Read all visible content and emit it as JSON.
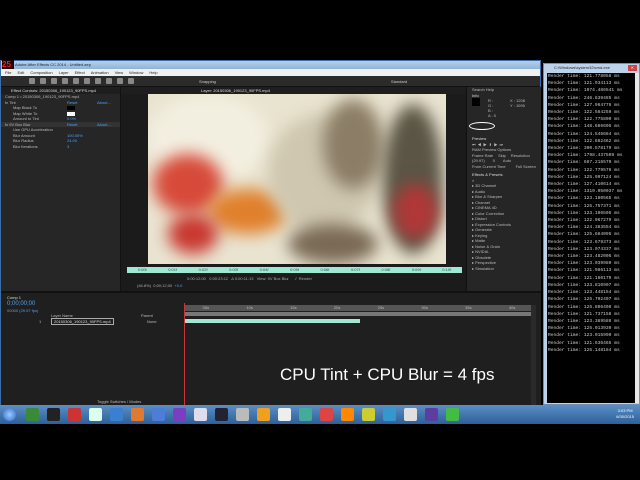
{
  "ae": {
    "title": "Adobe After Effects CC 2014 - Untitled.aep",
    "logo": "25",
    "menu": [
      "File",
      "Edit",
      "Composition",
      "Layer",
      "Effect",
      "Animation",
      "View",
      "Window",
      "Help"
    ],
    "workspace": "Standard",
    "effect_controls": {
      "tab": "Effect Controls: 20150306_190123_90FPS.mp4",
      "breadcrumb": "Comp 1 • 20150306_190123_90FPS.mp4",
      "rows": [
        {
          "name": "fx Tint",
          "value": "Reset",
          "about": "About..."
        },
        {
          "name": "Map Black To",
          "value": "",
          "about": ""
        },
        {
          "name": "Map White To",
          "value": "",
          "about": ""
        },
        {
          "name": "Amount to Tint",
          "value": "0.0%",
          "about": ""
        },
        {
          "name": "fx 9V Box Blur",
          "value": "Reset",
          "about": "About..."
        },
        {
          "name": "Use GPU Acceleration",
          "value": "",
          "about": ""
        },
        {
          "name": "Blur Amount",
          "value": "100.00%",
          "about": ""
        },
        {
          "name": "Blur Radius",
          "value": "24.00",
          "about": ""
        },
        {
          "name": "Blur Iterations",
          "value": "3",
          "about": ""
        }
      ]
    },
    "viewer": {
      "tab": "Layer: 20150306_190123_90FPS.mp4",
      "snap": "Snapping",
      "ruler": [
        "0:00f",
        "0:01f",
        "0:02f",
        "0:03f",
        "0:04f",
        "0:05f",
        "0:06f",
        "0:07f",
        "0:08f",
        "0:09f",
        "0:10f"
      ],
      "in": "0:00:12:00",
      "out": "0:00:23:12",
      "dur": "Δ 0:00:11:13",
      "view_label": "View:",
      "view": "9V Box Blur",
      "render": "✓ Render",
      "zoom": "(46.8%)",
      "time": "0;00;12;00",
      "offset": "+0.0"
    },
    "right": {
      "search": "Search Help",
      "info": "Info",
      "rgb": [
        "R :",
        "G :",
        "B :",
        "A : 0"
      ],
      "xy": [
        "X : 1208",
        "Y : 1095"
      ],
      "preview": "Preview",
      "ram": "RAM Preview Options",
      "fr_labels": [
        "Frame Rate",
        "Skip",
        "Resolution"
      ],
      "fr": [
        "(29.97)",
        "0",
        "Auto"
      ],
      "from_current": "From Current Time",
      "full_screen": "Full Screen",
      "effects": "Effects & Presets",
      "categories": [
        "3D Channel",
        "Audio",
        "Blur & Sharpen",
        "Channel",
        "CINEMA 4D",
        "Color Correction",
        "Distort",
        "Expression Controls",
        "Generate",
        "Keying",
        "Matte",
        "Noise & Grain",
        "NVIDIA",
        "Obsolete",
        "Perspective",
        "Simulation"
      ]
    },
    "timeline": {
      "tab": "Comp 1",
      "timecode": "0;00;00;00",
      "fps": "00000 (29.97 fps)",
      "col_layer": "Layer Name",
      "col_parent": "Parent",
      "layer_num": "1",
      "layer_name": "20150306_190123_90FPS.mp4",
      "parent": "None",
      "toggle": "Toggle Switches / Modes",
      "ticks": [
        "05s",
        "10s",
        "15s",
        "20s",
        "25s",
        "30s",
        "35s",
        "40s"
      ]
    }
  },
  "caption": "CPU Tint + CPU Blur = 4 fps",
  "console": {
    "title": "C:\\Windows\\system32\\cmd.exe",
    "label": "Render time:",
    "unit": "ms",
    "values": [
      "121.778058",
      "121.934113",
      "1974.486541",
      "246.639485",
      "127.964776",
      "122.584259",
      "122.775800",
      "148.686605",
      "124.546684",
      "122.682462",
      "300.578179",
      "1798.437509",
      "687.216570",
      "122.779576",
      "125.997124",
      "127.410614",
      "1310.050037",
      "123.180565",
      "125.757371",
      "123.106505",
      "122.067279",
      "124.383554",
      "125.684095",
      "123.679373",
      "123.074337",
      "123.482006",
      "123.039980",
      "121.986113",
      "121.160179",
      "123.810907",
      "123.448154",
      "125.702407",
      "125.806408",
      "121.737158",
      "123.389588",
      "125.013930",
      "123.015990",
      "121.636465",
      "125.148184"
    ]
  },
  "taskbar": {
    "time": "3:03 PM",
    "date": "6/30/2015",
    "colors": [
      "#3a8a3a",
      "#222",
      "#c33",
      "#dfe",
      "#3a7fd0",
      "#e07a30",
      "#4c7ed8",
      "#7a3fc0",
      "#dde",
      "#223",
      "#bbb",
      "#f0a020",
      "#eee",
      "#4a9",
      "#d44",
      "#f80",
      "#cc3",
      "#39c",
      "#e0e0e0",
      "#5a3fa0",
      "#4b4"
    ]
  }
}
